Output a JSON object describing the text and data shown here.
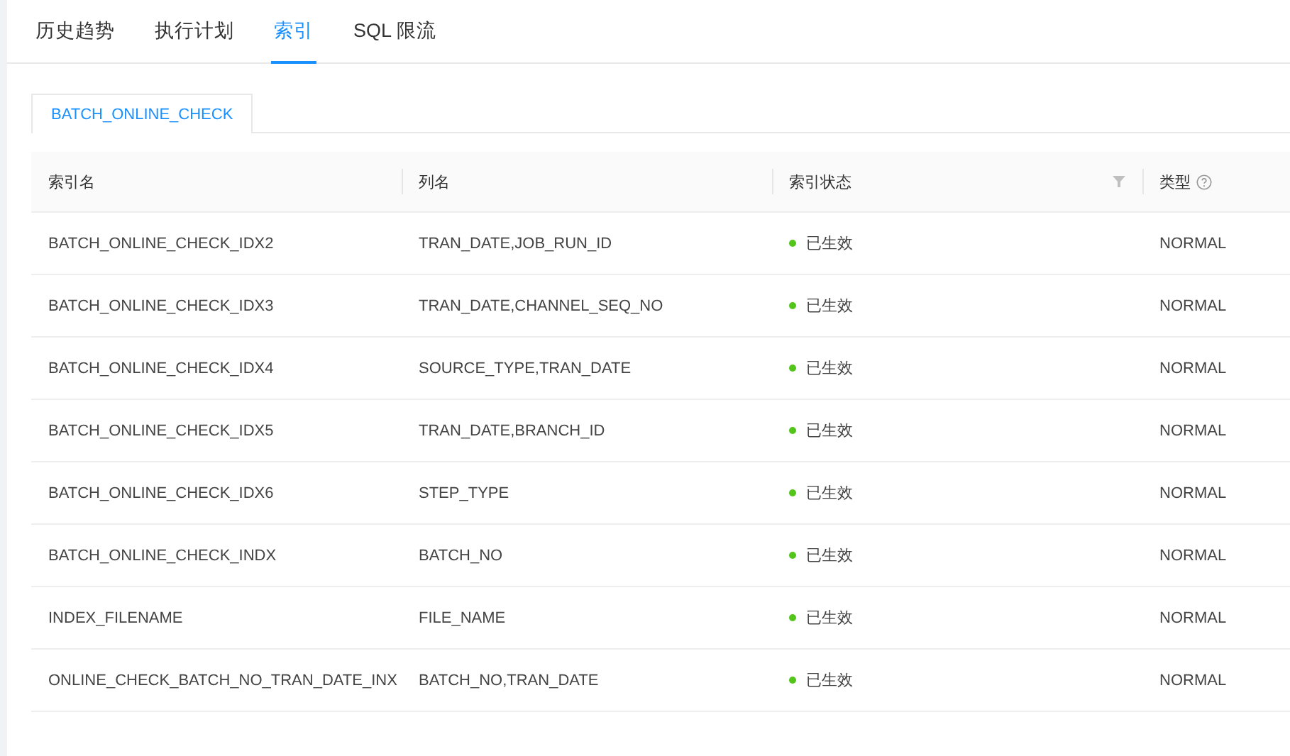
{
  "tabs": [
    {
      "label": "历史趋势",
      "selected": false
    },
    {
      "label": "执行计划",
      "selected": false
    },
    {
      "label": "索引",
      "selected": true
    },
    {
      "label": "SQL 限流",
      "selected": false
    }
  ],
  "table_tabs": [
    {
      "label": "BATCH_ONLINE_CHECK",
      "selected": true
    }
  ],
  "table": {
    "columns": [
      {
        "label": "索引名",
        "filter": false,
        "help": false
      },
      {
        "label": "列名",
        "filter": false,
        "help": false
      },
      {
        "label": "索引状态",
        "filter": true,
        "help": false
      },
      {
        "label": "类型",
        "filter": false,
        "help": true
      }
    ],
    "rows": [
      {
        "index_name": "BATCH_ONLINE_CHECK_IDX2",
        "columns": "TRAN_DATE,JOB_RUN_ID",
        "status": "已生效",
        "color": "#52c41a",
        "type": "NORMAL"
      },
      {
        "index_name": "BATCH_ONLINE_CHECK_IDX3",
        "columns": "TRAN_DATE,CHANNEL_SEQ_NO",
        "status": "已生效",
        "color": "#52c41a",
        "type": "NORMAL"
      },
      {
        "index_name": "BATCH_ONLINE_CHECK_IDX4",
        "columns": "SOURCE_TYPE,TRAN_DATE",
        "status": "已生效",
        "color": "#52c41a",
        "type": "NORMAL"
      },
      {
        "index_name": "BATCH_ONLINE_CHECK_IDX5",
        "columns": "TRAN_DATE,BRANCH_ID",
        "status": "已生效",
        "color": "#52c41a",
        "type": "NORMAL"
      },
      {
        "index_name": "BATCH_ONLINE_CHECK_IDX6",
        "columns": "STEP_TYPE",
        "status": "已生效",
        "color": "#52c41a",
        "type": "NORMAL"
      },
      {
        "index_name": "BATCH_ONLINE_CHECK_INDX",
        "columns": "BATCH_NO",
        "status": "已生效",
        "color": "#52c41a",
        "type": "NORMAL"
      },
      {
        "index_name": "INDEX_FILENAME",
        "columns": "FILE_NAME",
        "status": "已生效",
        "color": "#52c41a",
        "type": "NORMAL"
      },
      {
        "index_name": "ONLINE_CHECK_BATCH_NO_TRAN_DATE_INX",
        "columns": "BATCH_NO,TRAN_DATE",
        "status": "已生效",
        "color": "#52c41a",
        "type": "NORMAL"
      }
    ]
  }
}
